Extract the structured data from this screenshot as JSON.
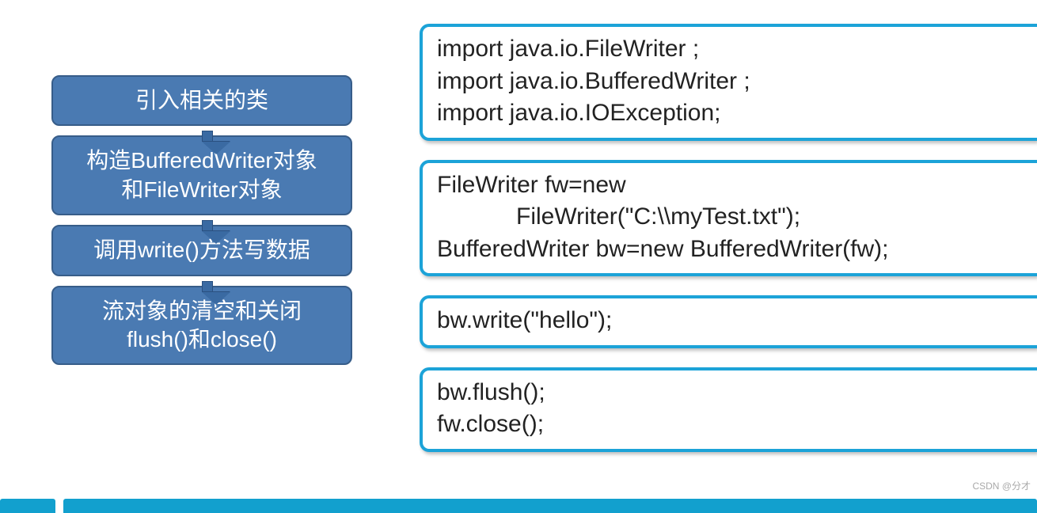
{
  "flow": {
    "step1": "引入相关的类",
    "step2_line1": "构造BufferedWriter对象",
    "step2_line2": "和FileWriter对象",
    "step3": "调用write()方法写数据",
    "step4_line1": "流对象的清空和关闭",
    "step4_line2": "flush()和close()"
  },
  "code": {
    "box1": "import java.io.FileWriter ;\nimport java.io.BufferedWriter ;\nimport java.io.IOException;",
    "box2": "FileWriter fw=new\n            FileWriter(\"C:\\\\myTest.txt\");\nBufferedWriter bw=new BufferedWriter(fw);",
    "box3": "bw.write(\"hello\");",
    "box4": "bw.flush();\nfw.close();"
  },
  "watermark": "CSDN @分才"
}
